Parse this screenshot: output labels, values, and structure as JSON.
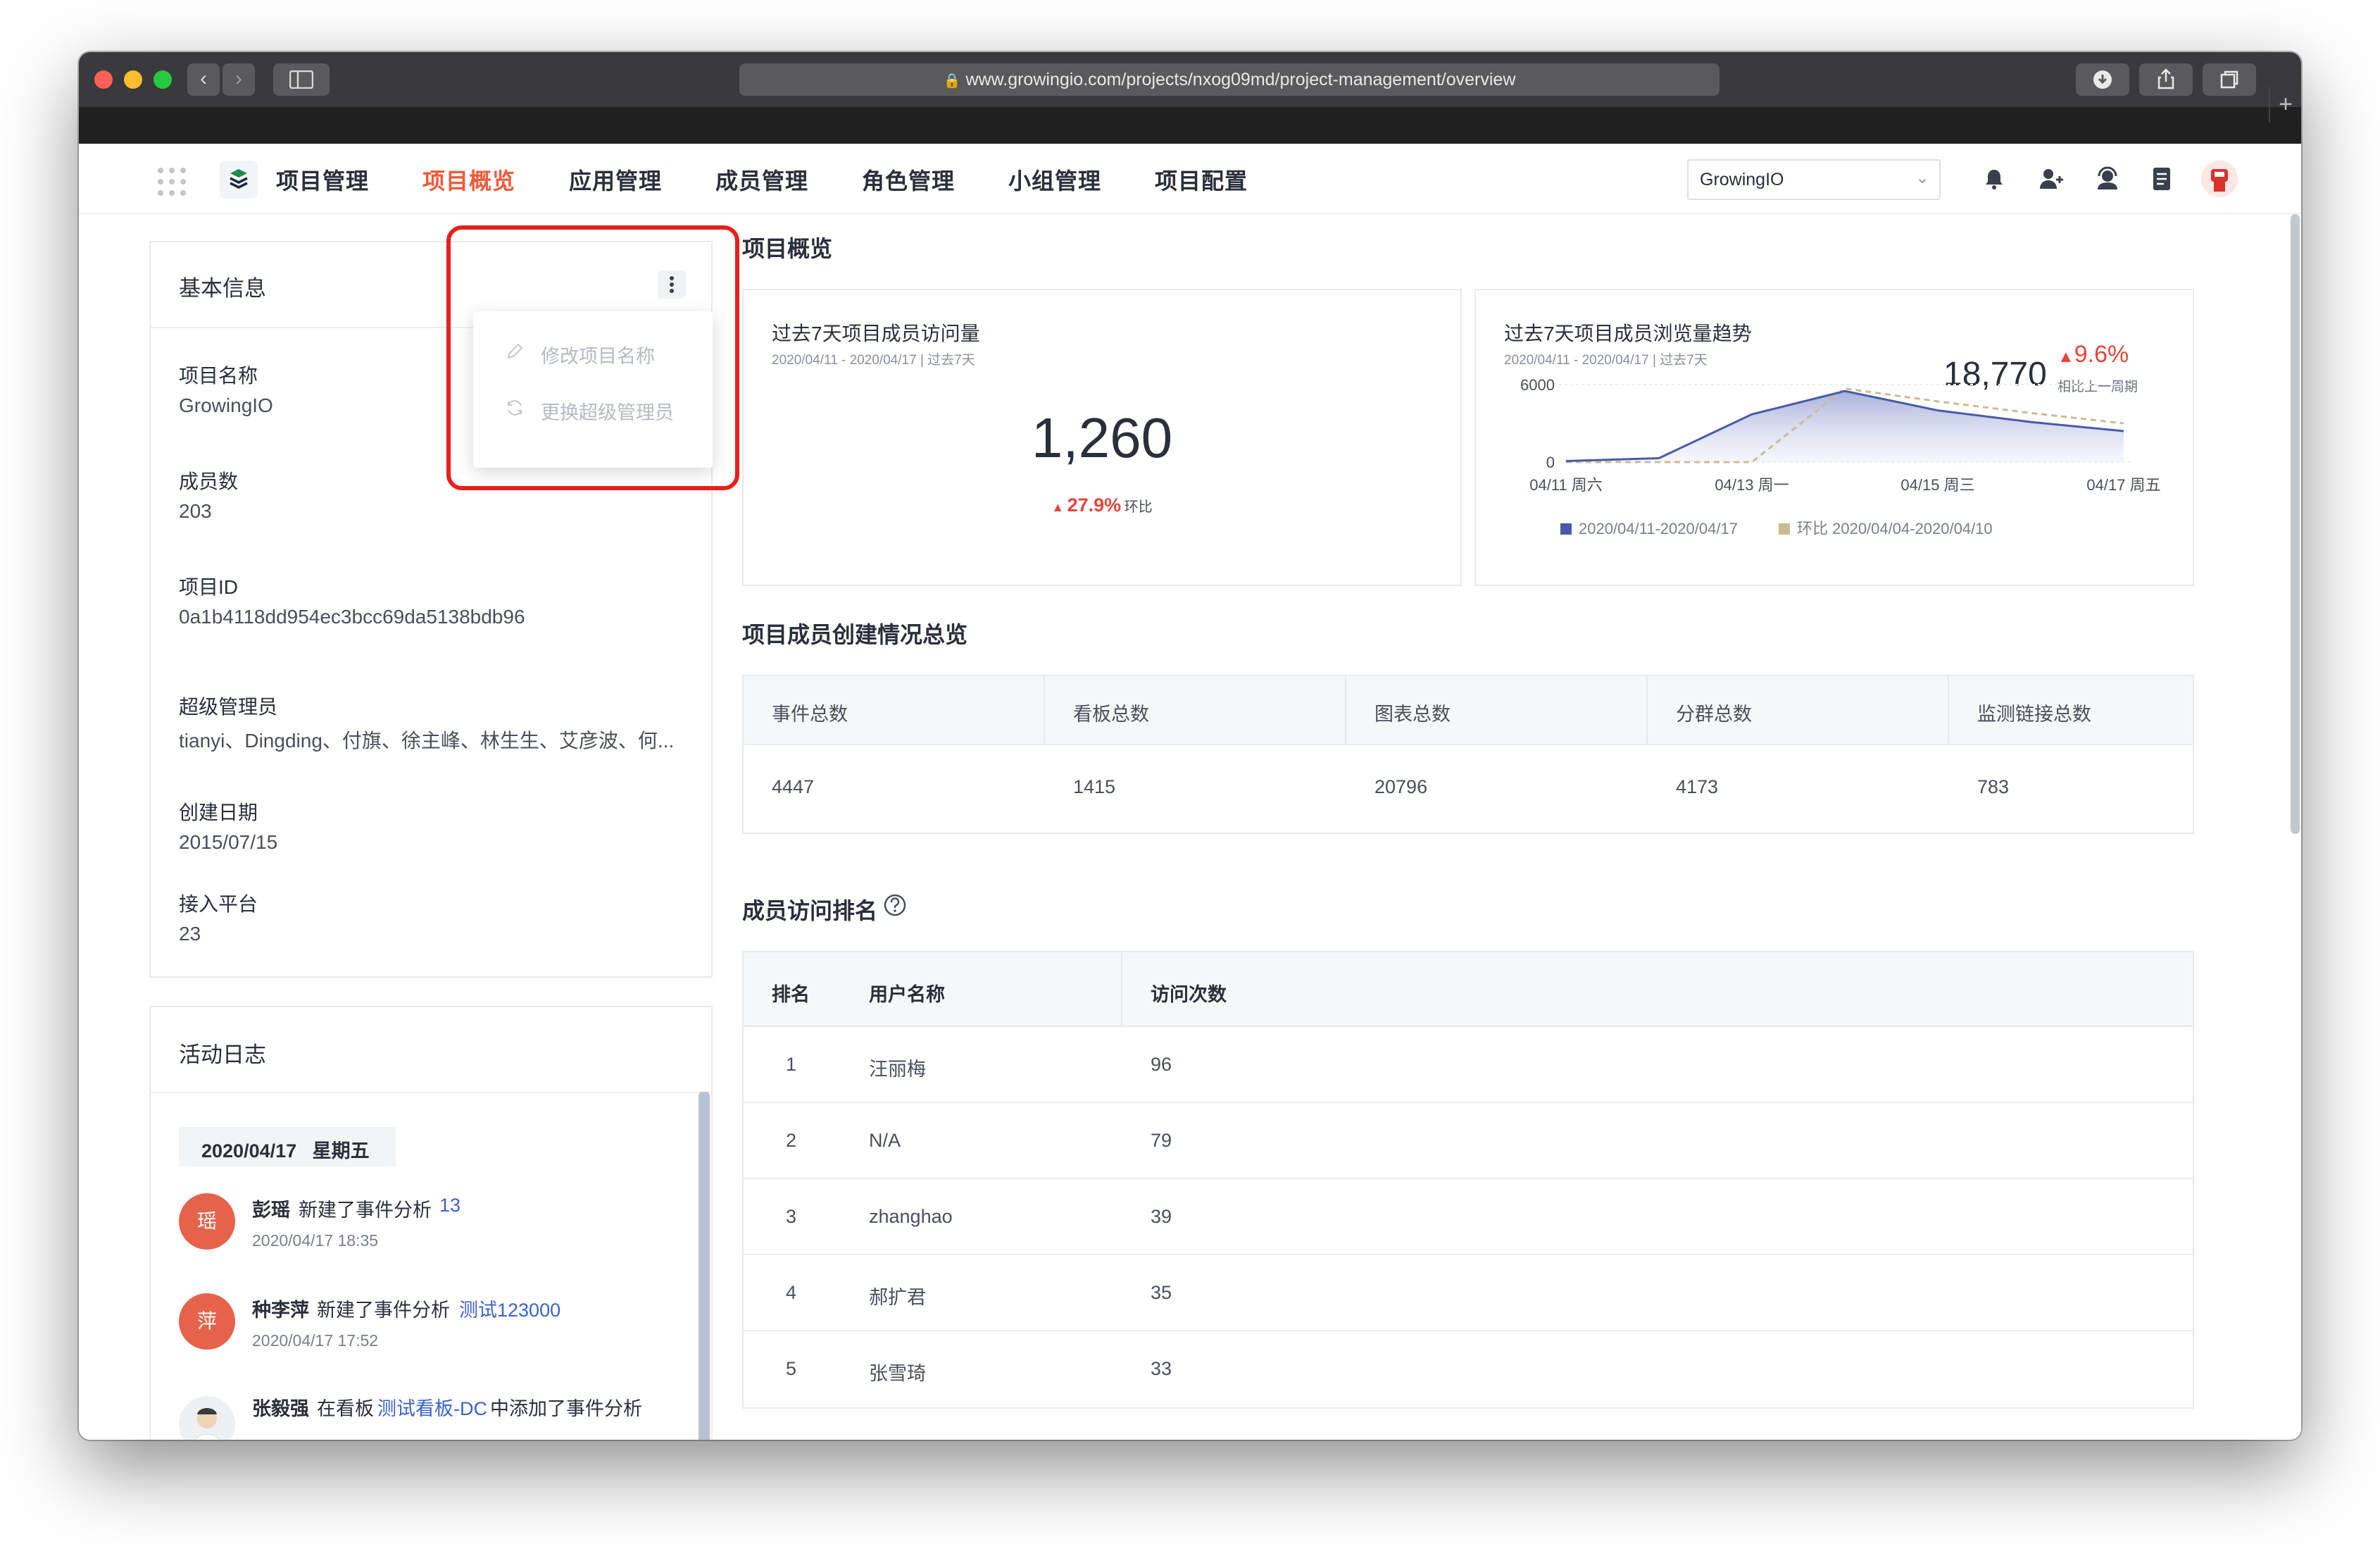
{
  "browser": {
    "url": "www.growingio.com/projects/nxog09md/project-management/overview"
  },
  "nav": {
    "brand": "项目管理",
    "items": [
      "项目概览",
      "应用管理",
      "成员管理",
      "角色管理",
      "小组管理",
      "项目配置"
    ],
    "active_index": 0,
    "project_select": "GrowingIO"
  },
  "basic_info": {
    "title": "基本信息",
    "menu": {
      "rename": "修改项目名称",
      "change_admin": "更换超级管理员"
    },
    "fields": [
      {
        "label": "项目名称",
        "value": "GrowingIO"
      },
      {
        "label": "成员数",
        "value": "203"
      },
      {
        "label": "项目ID",
        "value": "0a1b4118dd954ec3bcc69da5138bdb96"
      },
      {
        "label": "超级管理员",
        "value": "tianyi、Dingding、付旗、徐主峰、林生生、艾彦波、何..."
      },
      {
        "label": "创建日期",
        "value": "2015/07/15"
      },
      {
        "label": "接入平台",
        "value": "23"
      }
    ]
  },
  "activity_log": {
    "title": "活动日志",
    "date": "2020/04/17   星期五",
    "entries": [
      {
        "avatar": "瑶",
        "user": "彭瑶",
        "action": "新建了事件分析",
        "link": "13",
        "time": "2020/04/17 18:35"
      },
      {
        "avatar": "萍",
        "user": "种李萍",
        "action": "新建了事件分析",
        "link": "测试123000",
        "time": "2020/04/17 17:52"
      },
      {
        "avatar": "",
        "user": "张毅强",
        "action_pre": "在看板",
        "link": "测试看板-DC",
        "action_post": "中添加了事件分析"
      }
    ]
  },
  "overview": {
    "title": "项目概览",
    "visits": {
      "title": "过去7天项目成员访问量",
      "subtitle": "2020/04/11 - 2020/04/17 | 过去7天",
      "value": "1,260",
      "change": "27.9%",
      "change_label": "环比"
    },
    "trend": {
      "title": "过去7天项目成员浏览量趋势",
      "subtitle": "2020/04/11 - 2020/04/17 | 过去7天",
      "value": "18,770",
      "change": "9.6%",
      "change_label": "相比上一周期"
    }
  },
  "chart_data": {
    "type": "area",
    "x": [
      "04/11 周六",
      "04/12 周日",
      "04/13 周一",
      "04/14 周二",
      "04/15 周三",
      "04/16 周四",
      "04/17 周五"
    ],
    "x_tick_labels": [
      "04/11 周六",
      "04/13 周一",
      "04/15 周三",
      "04/17 周五"
    ],
    "y_tick_labels": [
      "6000",
      "0"
    ],
    "ylim": [
      0,
      6000
    ],
    "series": [
      {
        "name": "2020/04/11-2020/04/17",
        "color": "#4a5aa8",
        "values": [
          80,
          300,
          3700,
          5500,
          4000,
          3100,
          2400
        ]
      },
      {
        "name": "环比 2020/04/04-2020/04/10",
        "color": "#c8bd92",
        "values": [
          0,
          0,
          0,
          5700,
          4700,
          3800,
          3000
        ]
      }
    ],
    "legend": "bottom"
  },
  "creation": {
    "title": "项目成员创建情况总览",
    "headers": [
      "事件总数",
      "看板总数",
      "图表总数",
      "分群总数",
      "监测链接总数"
    ],
    "values": [
      "4447",
      "1415",
      "20796",
      "4173",
      "783"
    ]
  },
  "ranking": {
    "title": "成员访问排名",
    "headers": [
      "排名",
      "用户名称",
      "访问次数"
    ],
    "rows": [
      [
        "1",
        "汪丽梅",
        "96"
      ],
      [
        "2",
        "N/A",
        "79"
      ],
      [
        "3",
        "zhanghao",
        "39"
      ],
      [
        "4",
        "郝扩君",
        "35"
      ],
      [
        "5",
        "张雪琦",
        "33"
      ]
    ]
  },
  "colors": {
    "accent": "#ef5a3c",
    "up": "#e5463a",
    "link": "#3b62c7",
    "highlight_box": "#e6201c",
    "series_primary": "#4a5aa8",
    "series_compare": "#c8bd92"
  }
}
